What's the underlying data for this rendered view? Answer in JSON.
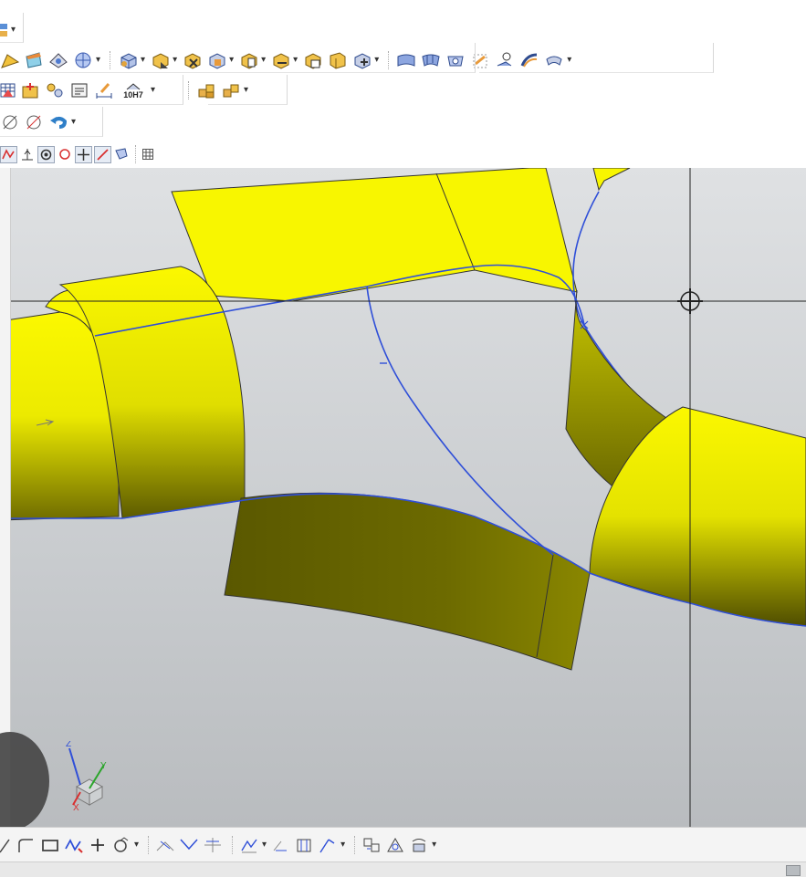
{
  "toolbars": {
    "row1": [
      "component-icon"
    ],
    "row2": [
      "sketch-icon",
      "plane-icon",
      "fold-icon",
      "sphere-icon",
      "solid-box-icon",
      "feature-a-icon",
      "feature-b-icon",
      "feature-c-icon",
      "feature-d-icon",
      "feature-e-icon",
      "feature-f-icon",
      "feature-g-icon",
      "feature-h-icon",
      "surface-a-icon",
      "surface-b-icon",
      "surface-c-icon",
      "surface-d-icon",
      "surface-e-icon",
      "surface-f-icon",
      "surface-g-icon"
    ],
    "row3": [
      "table-icon",
      "datum-icon",
      "constraint-icon",
      "note-icon",
      "dimension-icon",
      "tolerance-icon",
      "assembly-a-icon",
      "assembly-b-icon"
    ],
    "row3_tolerance_label": "10H7",
    "row4": [
      "diameter-icon",
      "diameter-dim-icon",
      "undo-arrow-icon"
    ],
    "row5": [
      "snap-curve-icon",
      "snap-perpendicular-icon",
      "snap-center-icon",
      "snap-circle-icon",
      "snap-cross-icon",
      "snap-tangent-icon",
      "snap-filter-icon",
      "grid-icon"
    ]
  },
  "viewport": {
    "surface_color": "#f8f600",
    "edge_color": "#2f4fd8",
    "background_top": "#dfe1e3",
    "background_bottom": "#b9bcbf"
  },
  "axis_triad": {
    "x": "X",
    "y": "Y",
    "z": "Z"
  },
  "bottom_toolbar": [
    "line-icon",
    "polyline-icon",
    "rectangle-icon",
    "spline-icon",
    "point-icon",
    "shape-icon",
    "trim-icon",
    "extend-icon",
    "split-icon",
    "offset-icon",
    "mirror-icon",
    "pattern-icon",
    "project-icon",
    "intersect-icon",
    "convert-icon"
  ]
}
